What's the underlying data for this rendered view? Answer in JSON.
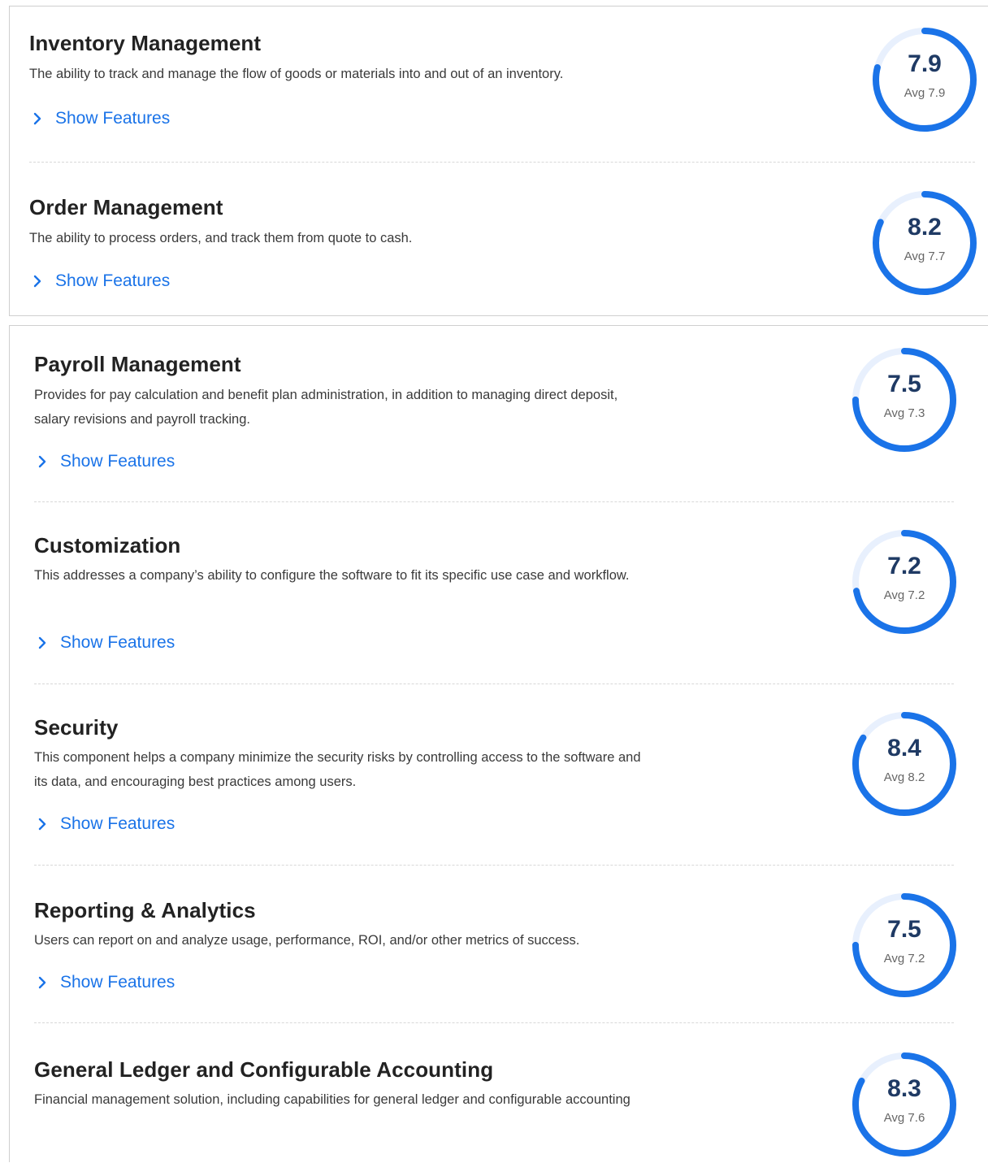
{
  "show_features_label": "Show Features",
  "accent_color": "#1a73e8",
  "track_color": "#e8f0fd",
  "score_color": "#1f3a64",
  "panels": [
    {
      "items": [
        {
          "title": "Inventory Management",
          "description": "The ability to track and manage the flow of goods or materials into and out of an inventory.",
          "score": "7.9",
          "score_value": 7.9,
          "avg_label": "Avg 7.9"
        },
        {
          "title": "Order Management",
          "description": "The ability to process orders, and track them from quote to cash.",
          "score": "8.2",
          "score_value": 8.2,
          "avg_label": "Avg 7.7"
        }
      ]
    },
    {
      "items": [
        {
          "title": "Payroll Management",
          "description": "Provides for pay calculation and benefit plan administration, in addition to managing direct deposit, salary revisions and payroll tracking.",
          "score": "7.5",
          "score_value": 7.5,
          "avg_label": "Avg 7.3"
        },
        {
          "title": "Customization",
          "description": "This addresses a company’s ability to configure the software to fit its specific use case and workflow.",
          "score": "7.2",
          "score_value": 7.2,
          "avg_label": "Avg 7.2"
        },
        {
          "title": "Security",
          "description": "This component helps a company minimize the security risks by controlling access to the software and its data, and encouraging best practices among users.",
          "score": "8.4",
          "score_value": 8.4,
          "avg_label": "Avg 8.2"
        },
        {
          "title": "Reporting & Analytics",
          "description": "Users can report on and analyze usage, performance, ROI, and/or other metrics of success.",
          "score": "7.5",
          "score_value": 7.5,
          "avg_label": "Avg 7.2"
        },
        {
          "title": "General Ledger and Configurable Accounting",
          "description": "Financial management solution, including capabilities for general ledger and configurable accounting",
          "score": "8.3",
          "score_value": 8.3,
          "avg_label": "Avg 7.6"
        }
      ]
    }
  ]
}
